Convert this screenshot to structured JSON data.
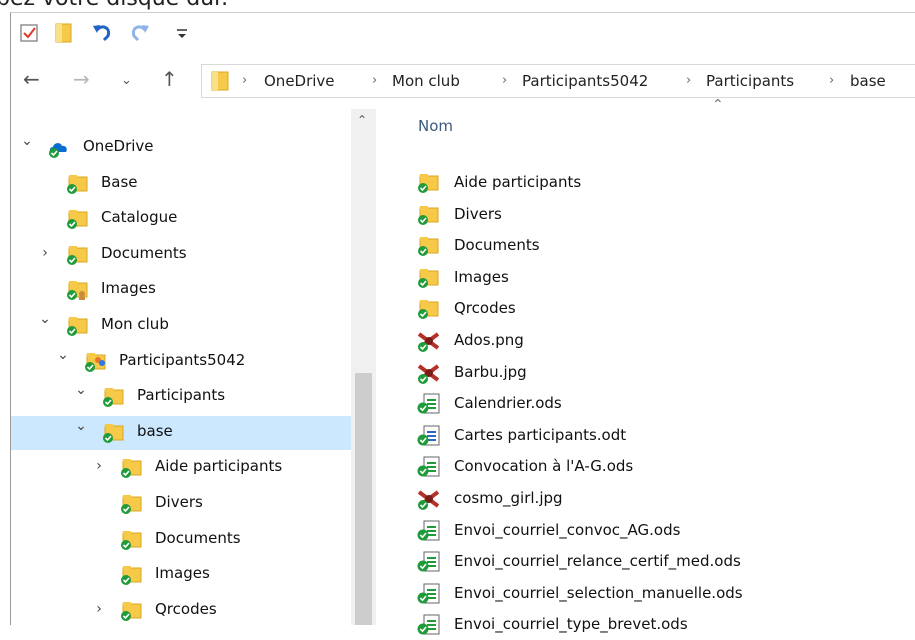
{
  "caption": "bez votre disque dur.",
  "quick_access": {
    "properties_icon": "checkbox-properties-icon",
    "new_folder_icon": "folder-icon",
    "undo_icon": "undo-icon",
    "redo_icon": "redo-icon",
    "customize_icon": "customize-dropdown-icon"
  },
  "address": {
    "crumbs": [
      "OneDrive",
      "Mon club",
      "Participants5042",
      "Participants",
      "base"
    ]
  },
  "colors": {
    "selection": "#cce8ff",
    "folder": "#f7c948",
    "sync_green": "#1f9b3a",
    "onedrive_blue": "#0a6ed1"
  },
  "nav_tree": [
    {
      "label": "OneDrive",
      "chevron": "down",
      "icon": "onedrive-cloud-icon"
    },
    {
      "label": "Base",
      "chevron": "",
      "icon": "synced-folder-icon"
    },
    {
      "label": "Catalogue",
      "chevron": "",
      "icon": "synced-folder-icon"
    },
    {
      "label": "Documents",
      "chevron": "right",
      "icon": "synced-folder-icon"
    },
    {
      "label": "Images",
      "chevron": "",
      "icon": "shared-folder-icon"
    },
    {
      "label": "Mon club",
      "chevron": "down",
      "icon": "synced-folder-icon"
    },
    {
      "label": "Participants5042",
      "chevron": "down",
      "icon": "shared-people-folder-icon"
    },
    {
      "label": "Participants",
      "chevron": "down",
      "icon": "synced-folder-icon"
    },
    {
      "label": "base",
      "chevron": "down",
      "icon": "synced-folder-icon"
    },
    {
      "label": "Aide participants",
      "chevron": "right",
      "icon": "synced-folder-icon"
    },
    {
      "label": "Divers",
      "chevron": "",
      "icon": "synced-folder-icon"
    },
    {
      "label": "Documents",
      "chevron": "",
      "icon": "synced-folder-icon"
    },
    {
      "label": "Images",
      "chevron": "",
      "icon": "synced-folder-icon"
    },
    {
      "label": "Qrcodes",
      "chevron": "right",
      "icon": "synced-folder-icon"
    }
  ],
  "file_list": {
    "column_header": "Nom",
    "items": [
      {
        "name": "Aide participants",
        "icon": "synced-folder-icon"
      },
      {
        "name": "Divers",
        "icon": "synced-folder-icon"
      },
      {
        "name": "Documents",
        "icon": "synced-folder-icon"
      },
      {
        "name": "Images",
        "icon": "synced-folder-icon"
      },
      {
        "name": "Qrcodes",
        "icon": "synced-folder-icon"
      },
      {
        "name": "Ados.png",
        "icon": "image-file-icon"
      },
      {
        "name": "Barbu.jpg",
        "icon": "image-file-icon"
      },
      {
        "name": "Calendrier.ods",
        "icon": "spreadsheet-file-icon"
      },
      {
        "name": "Cartes participants.odt",
        "icon": "text-document-file-icon"
      },
      {
        "name": "Convocation à l'A-G.ods",
        "icon": "spreadsheet-file-icon"
      },
      {
        "name": "cosmo_girl.jpg",
        "icon": "image-file-icon"
      },
      {
        "name": "Envoi_courriel_convoc_AG.ods",
        "icon": "spreadsheet-file-icon"
      },
      {
        "name": "Envoi_courriel_relance_certif_med.ods",
        "icon": "spreadsheet-file-icon"
      },
      {
        "name": "Envoi_courriel_selection_manuelle.ods",
        "icon": "spreadsheet-file-icon"
      },
      {
        "name": "Envoi_courriel_type_brevet.ods",
        "icon": "spreadsheet-file-icon"
      }
    ]
  }
}
